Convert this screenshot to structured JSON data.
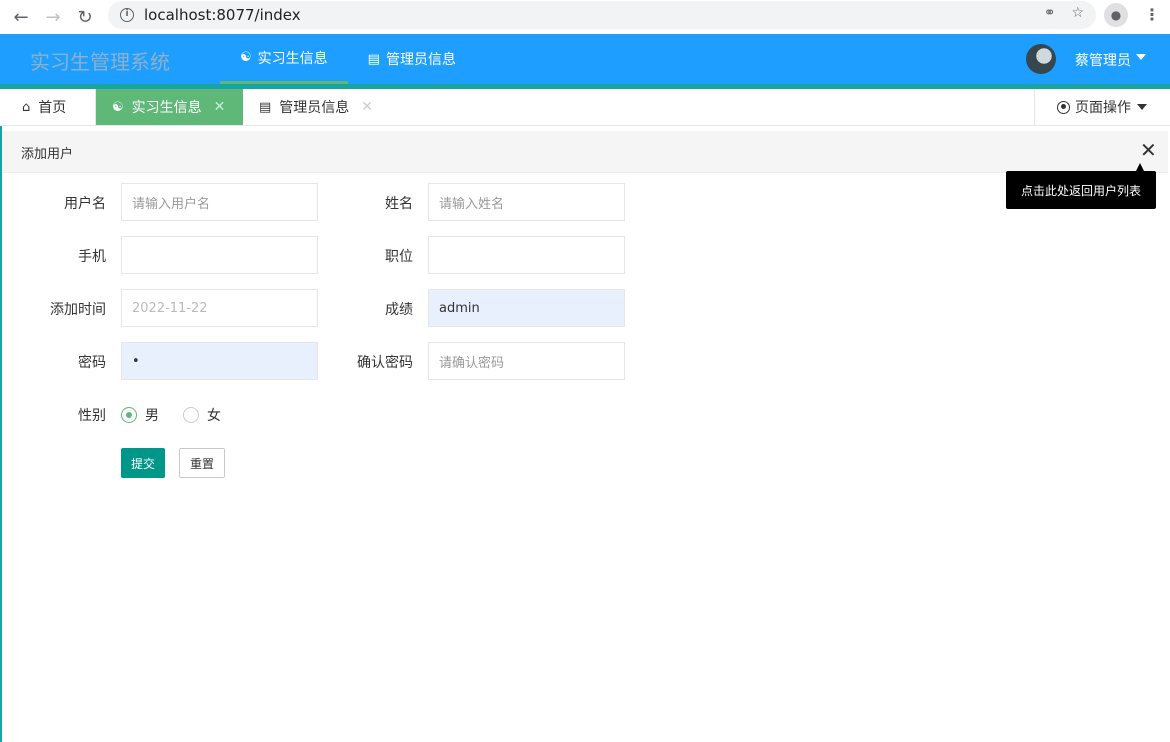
{
  "browser": {
    "url": "localhost:8077/index",
    "back_icon": "arrow-left-icon",
    "forward_icon": "arrow-right-icon",
    "reload_icon": "reload-icon"
  },
  "app": {
    "logo": "实习生管理系统",
    "nav": [
      {
        "label": "实习生信息",
        "icon": "users-icon"
      },
      {
        "label": "管理员信息",
        "icon": "clipboard-icon"
      }
    ],
    "user_name": "蔡管理员",
    "colors": {
      "header": "#1e9fff",
      "accent": "#5fb878",
      "submit": "#009688"
    }
  },
  "tabs": {
    "items": [
      {
        "label": "首页",
        "icon": "home-icon"
      },
      {
        "label": "实习生信息",
        "icon": "users-icon"
      },
      {
        "label": "管理员信息",
        "icon": "clipboard-icon"
      }
    ],
    "page_ops": "页面操作"
  },
  "form": {
    "title": "添加用户",
    "tooltip": "点击此处返回用户列表",
    "fields": {
      "username_label": "用户名",
      "username_placeholder": "请输入用户名",
      "name_label": "姓名",
      "name_placeholder": "请输入姓名",
      "phone_label": "手机",
      "position_label": "职位",
      "addtime_label": "添加时间",
      "addtime_value": "2022-11-22",
      "score_label": "成绩",
      "score_value": "admin",
      "password_label": "密码",
      "password_value": "•",
      "confirm_label": "确认密码",
      "confirm_placeholder": "请确认密码",
      "gender_label": "性别",
      "gender_male": "男",
      "gender_female": "女"
    },
    "submit_label": "提交",
    "reset_label": "重置"
  }
}
